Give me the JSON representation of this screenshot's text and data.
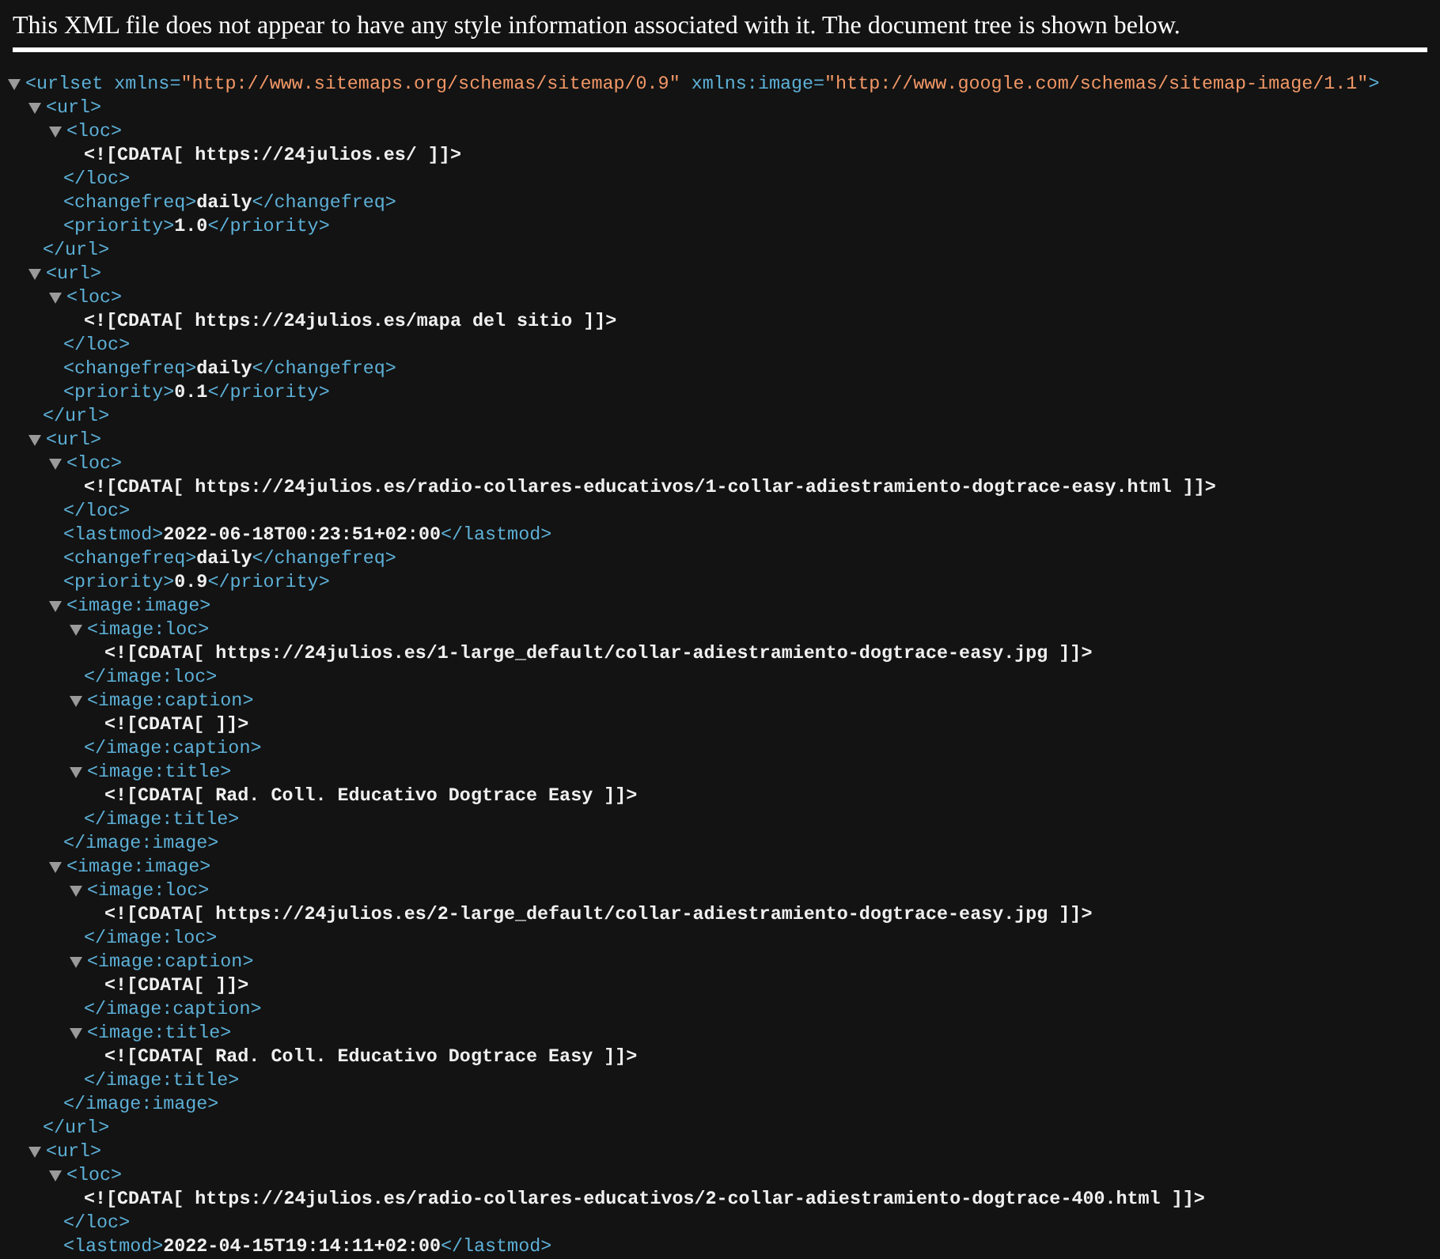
{
  "header": {
    "message": "This XML file does not appear to have any style information associated with it. The document tree is shown below."
  },
  "tree": {
    "kind": "element",
    "open": "<urlset",
    "attributes": [
      {
        "name": " xmlns=",
        "value": "\"http://www.sitemaps.org/schemas/sitemap/0.9\""
      },
      {
        "name": " xmlns:image=",
        "value": "\"http://www.google.com/schemas/sitemap-image/1.1\""
      }
    ],
    "open_end": ">",
    "expanded": true,
    "children": [
      {
        "kind": "element",
        "open": "<url>",
        "close": "</url>",
        "expanded": true,
        "children": [
          {
            "kind": "element",
            "open": "<loc>",
            "close": "</loc>",
            "expanded": true,
            "children": [
              {
                "kind": "cdata",
                "text": "<![CDATA[ https://24julios.es/ ]]>"
              }
            ]
          },
          {
            "kind": "leaf",
            "open": "<changefreq>",
            "text": "daily",
            "close": "</changefreq>"
          },
          {
            "kind": "leaf",
            "open": "<priority>",
            "text": "1.0",
            "close": "</priority>"
          }
        ]
      },
      {
        "kind": "element",
        "open": "<url>",
        "close": "</url>",
        "expanded": true,
        "children": [
          {
            "kind": "element",
            "open": "<loc>",
            "close": "</loc>",
            "expanded": true,
            "children": [
              {
                "kind": "cdata",
                "text": "<![CDATA[ https://24julios.es/mapa del sitio ]]>"
              }
            ]
          },
          {
            "kind": "leaf",
            "open": "<changefreq>",
            "text": "daily",
            "close": "</changefreq>"
          },
          {
            "kind": "leaf",
            "open": "<priority>",
            "text": "0.1",
            "close": "</priority>"
          }
        ]
      },
      {
        "kind": "element",
        "open": "<url>",
        "close": "</url>",
        "expanded": true,
        "children": [
          {
            "kind": "element",
            "open": "<loc>",
            "close": "</loc>",
            "expanded": true,
            "children": [
              {
                "kind": "cdata",
                "text": "<![CDATA[ https://24julios.es/radio-collares-educativos/1-collar-adiestramiento-dogtrace-easy.html ]]>"
              }
            ]
          },
          {
            "kind": "leaf",
            "open": "<lastmod>",
            "text": "2022-06-18T00:23:51+02:00",
            "close": "</lastmod>"
          },
          {
            "kind": "leaf",
            "open": "<changefreq>",
            "text": "daily",
            "close": "</changefreq>"
          },
          {
            "kind": "leaf",
            "open": "<priority>",
            "text": "0.9",
            "close": "</priority>"
          },
          {
            "kind": "element",
            "open": "<image:image>",
            "close": "</image:image>",
            "expanded": true,
            "children": [
              {
                "kind": "element",
                "open": "<image:loc>",
                "close": "</image:loc>",
                "expanded": true,
                "children": [
                  {
                    "kind": "cdata",
                    "text": "<![CDATA[ https://24julios.es/1-large_default/collar-adiestramiento-dogtrace-easy.jpg ]]>"
                  }
                ]
              },
              {
                "kind": "element",
                "open": "<image:caption>",
                "close": "</image:caption>",
                "expanded": true,
                "children": [
                  {
                    "kind": "cdata",
                    "text": "<![CDATA[ ]]>"
                  }
                ]
              },
              {
                "kind": "element",
                "open": "<image:title>",
                "close": "</image:title>",
                "expanded": true,
                "children": [
                  {
                    "kind": "cdata",
                    "text": "<![CDATA[ Rad. Coll. Educativo Dogtrace Easy ]]>"
                  }
                ]
              }
            ]
          },
          {
            "kind": "element",
            "open": "<image:image>",
            "close": "</image:image>",
            "expanded": true,
            "children": [
              {
                "kind": "element",
                "open": "<image:loc>",
                "close": "</image:loc>",
                "expanded": true,
                "children": [
                  {
                    "kind": "cdata",
                    "text": "<![CDATA[ https://24julios.es/2-large_default/collar-adiestramiento-dogtrace-easy.jpg ]]>"
                  }
                ]
              },
              {
                "kind": "element",
                "open": "<image:caption>",
                "close": "</image:caption>",
                "expanded": true,
                "children": [
                  {
                    "kind": "cdata",
                    "text": "<![CDATA[ ]]>"
                  }
                ]
              },
              {
                "kind": "element",
                "open": "<image:title>",
                "close": "</image:title>",
                "expanded": true,
                "children": [
                  {
                    "kind": "cdata",
                    "text": "<![CDATA[ Rad. Coll. Educativo Dogtrace Easy ]]>"
                  }
                ]
              }
            ]
          }
        ]
      },
      {
        "kind": "element",
        "open": "<url>",
        "expanded": true,
        "children": [
          {
            "kind": "element",
            "open": "<loc>",
            "close": "</loc>",
            "expanded": true,
            "children": [
              {
                "kind": "cdata",
                "text": "<![CDATA[ https://24julios.es/radio-collares-educativos/2-collar-adiestramiento-dogtrace-400.html ]]>"
              }
            ]
          },
          {
            "kind": "leaf",
            "open": "<lastmod>",
            "text": "2022-04-15T19:14:11+02:00",
            "close": "</lastmod>"
          }
        ]
      }
    ]
  }
}
